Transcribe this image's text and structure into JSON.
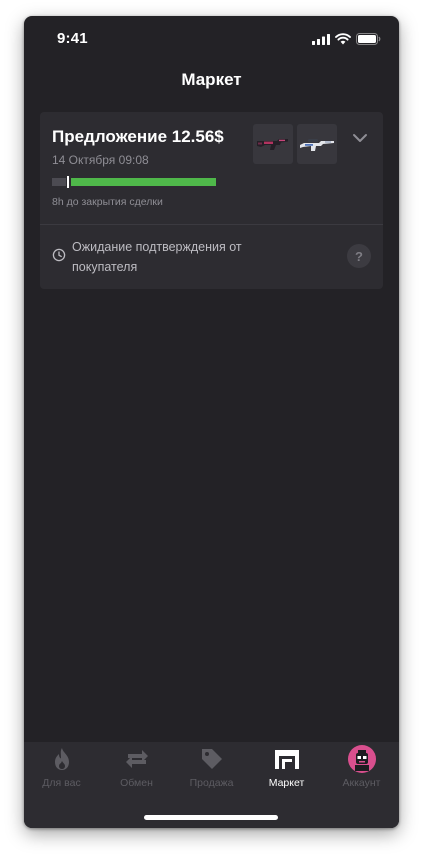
{
  "status_bar": {
    "time": "9:41"
  },
  "header": {
    "title": "Маркет"
  },
  "offer": {
    "title": "Предложение 12.56$",
    "date": "14 Октября 09:08",
    "deadline": "8h до закрытия сделки",
    "time_elapsed_fraction": 0.1,
    "status_text": "Ожидание подтверждения от покупателя",
    "help_label": "?",
    "items": [
      {
        "icon": "rifle-skin-icon"
      },
      {
        "icon": "sniper-rifle-skin-icon"
      }
    ]
  },
  "tab_bar": {
    "tabs": [
      {
        "label": "Для вас",
        "icon": "flame-icon",
        "active": false
      },
      {
        "label": "Обмен",
        "icon": "swap-icon",
        "active": false
      },
      {
        "label": "Продажа",
        "icon": "price-tag-icon",
        "active": false
      },
      {
        "label": "Маркет",
        "icon": "market-stall-icon",
        "active": true
      },
      {
        "label": "Аккаунт",
        "icon": "avatar",
        "active": false
      }
    ]
  },
  "colors": {
    "background": "#232226",
    "card": "#2d2c31",
    "progress_remaining": "#4fb84a",
    "progress_elapsed": "#4c4b52",
    "avatar": "#d94f8e"
  }
}
